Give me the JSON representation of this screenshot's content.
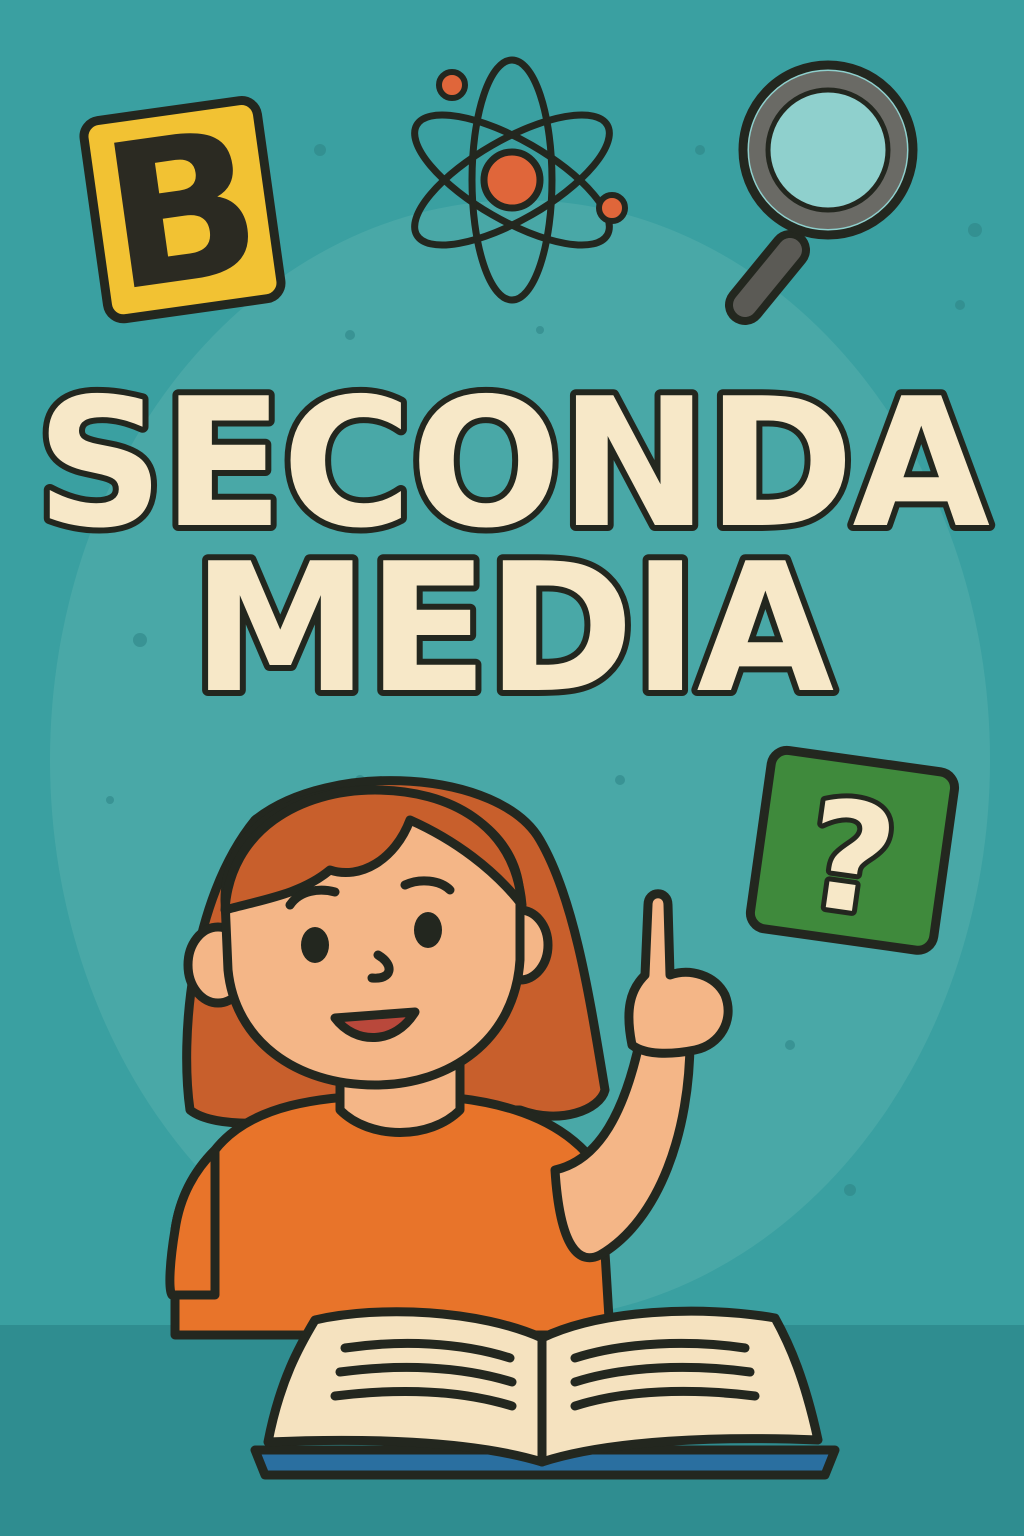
{
  "title": {
    "line1": "SECONDA",
    "line2": "MEDIA"
  },
  "icons": {
    "letter_tile": {
      "name": "letter-b-icon",
      "glyph": "B"
    },
    "atom": {
      "name": "atom-icon"
    },
    "magnifier": {
      "name": "magnifying-glass-icon"
    },
    "question_tile": {
      "name": "question-mark-icon",
      "glyph": "?"
    },
    "book": {
      "name": "open-book-icon"
    }
  },
  "illustration": {
    "name": "girl-pointing-up"
  },
  "colors": {
    "background": "#3aa0a1",
    "background_halo": "#5bb6b2",
    "title_fill": "#f7e8c8",
    "outline": "#23271f",
    "letter_tile": "#f2c233",
    "atom_nucleus": "#e0663a",
    "question_tile": "#3f8a3c",
    "hair": "#c85f2c",
    "skin": "#f4b687",
    "shirt": "#e8742a",
    "book_pages": "#f5e2bf",
    "book_cover": "#2a6fa0",
    "table": "#2f8d90"
  }
}
